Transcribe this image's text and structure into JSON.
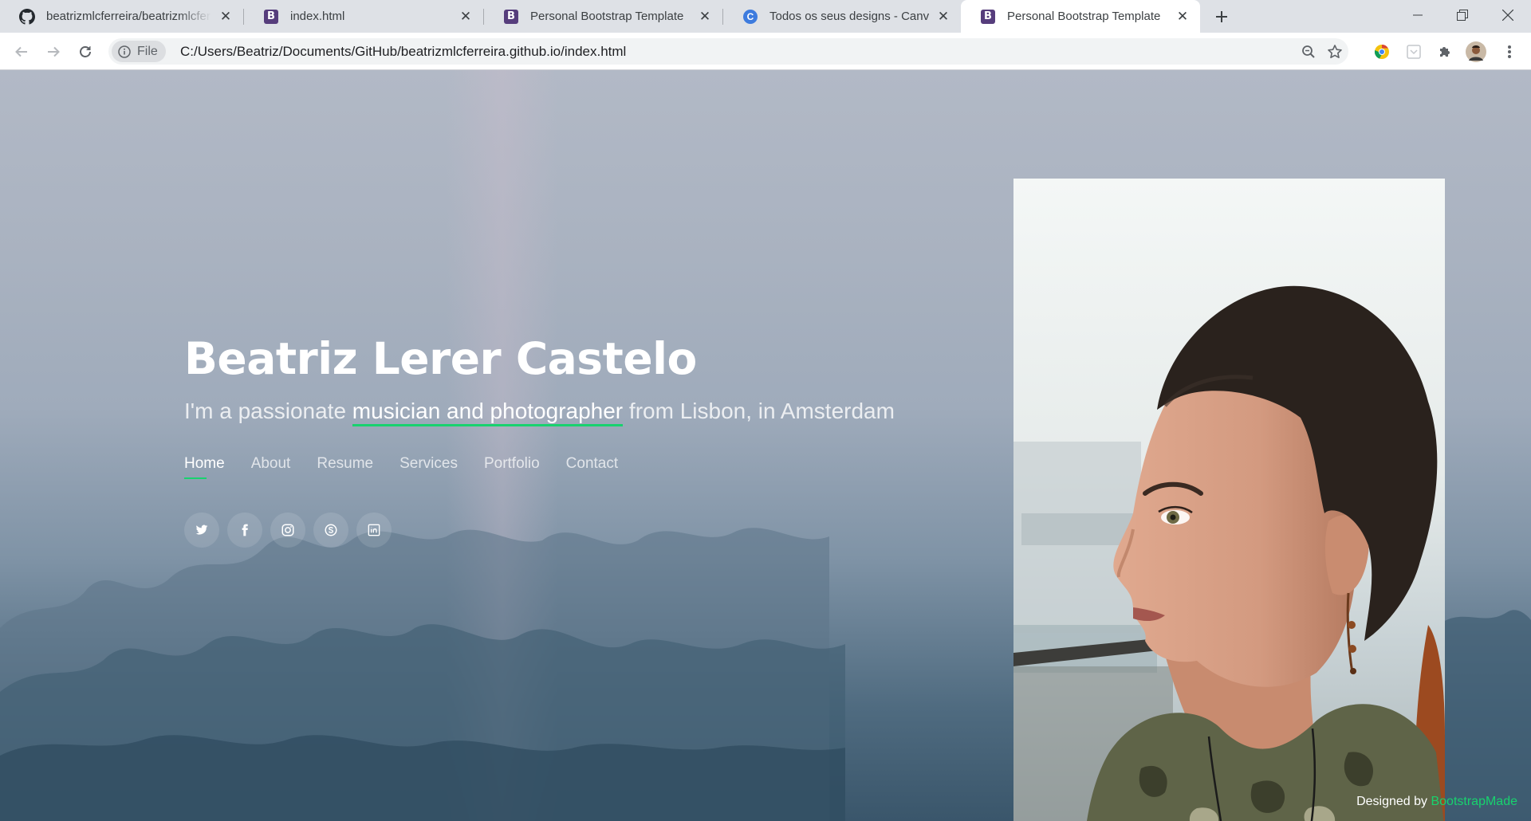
{
  "browser": {
    "tabs": [
      {
        "title": "beatrizmlcferreira/beatrizmlcferreira",
        "favicon": "github-icon",
        "active": false
      },
      {
        "title": "index.html",
        "favicon": "bootstrap-icon",
        "active": false
      },
      {
        "title": "Personal Bootstrap Template",
        "favicon": "bootstrap-icon",
        "active": false
      },
      {
        "title": "Todos os seus designs - Canva",
        "favicon": "canva-icon",
        "active": false
      },
      {
        "title": "Personal Bootstrap Template",
        "favicon": "bootstrap-icon",
        "active": true
      }
    ],
    "chip_label": "File",
    "url": "C:/Users/Beatriz/Documents/GitHub/beatrizmlcferreira.github.io/index.html"
  },
  "hero": {
    "name": "Beatriz Lerer Castelo",
    "tagline_prefix": "I'm a passionate ",
    "tagline_typed": "musician and photographer",
    "tagline_suffix": " from Lisbon, in Amsterdam",
    "nav": [
      "Home",
      "About",
      "Resume",
      "Services",
      "Portfolio",
      "Contact"
    ],
    "active_nav": "Home",
    "socials": [
      "twitter-icon",
      "facebook-icon",
      "instagram-icon",
      "skype-icon",
      "linkedin-icon"
    ]
  },
  "credits": {
    "prefix": "Designed by ",
    "link": "BootstrapMade"
  },
  "colors": {
    "accent": "#18d26e",
    "tab_strip": "#dee1e6",
    "bootstrap_purple": "#563d7c"
  }
}
